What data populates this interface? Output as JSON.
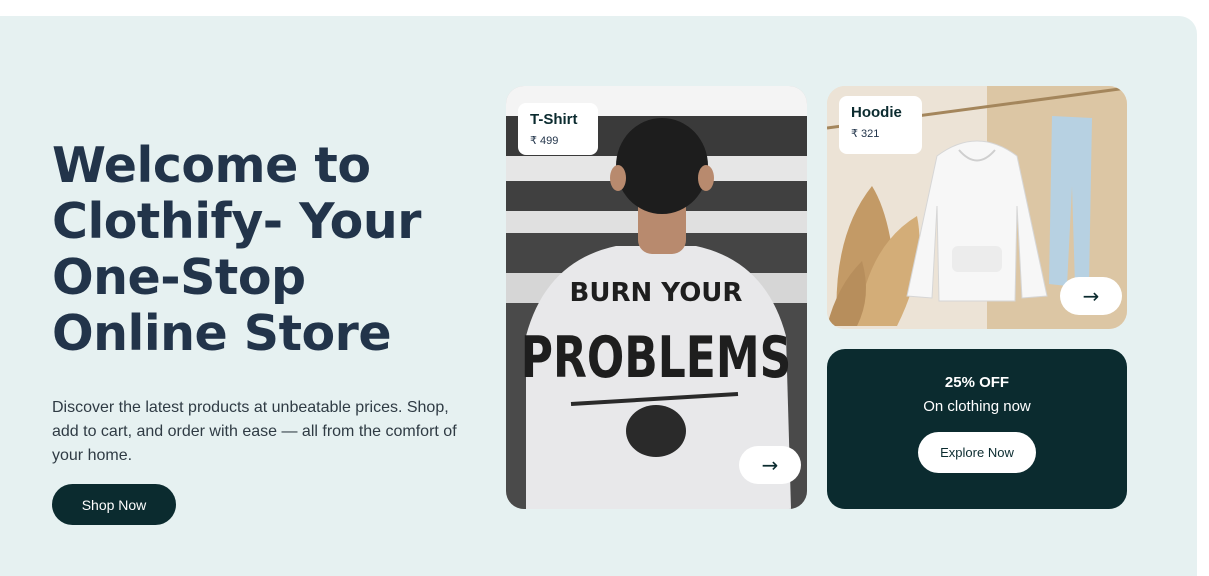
{
  "hero": {
    "title": "Welcome to Clothify- Your One-Stop Online Store",
    "description": "Discover the latest products at unbeatable prices. Shop, add to cart, and order with ease — all from the comfort of your home.",
    "cta_label": "Shop Now"
  },
  "products": [
    {
      "name": "T-Shirt",
      "price": "₹ 499",
      "arrow": "→",
      "print_line1": "BURN YOUR",
      "print_line2": "PROBLEMS"
    },
    {
      "name": "Hoodie",
      "price": "₹ 321",
      "arrow": "→"
    }
  ],
  "promo": {
    "title": "25% OFF",
    "subtitle": "On clothing now",
    "button_label": "Explore Now"
  },
  "colors": {
    "background": "#e6f1f1",
    "heading": "#22344a",
    "primary": "#0b2b2f"
  },
  "icons": [
    "arrow-right-icon"
  ]
}
